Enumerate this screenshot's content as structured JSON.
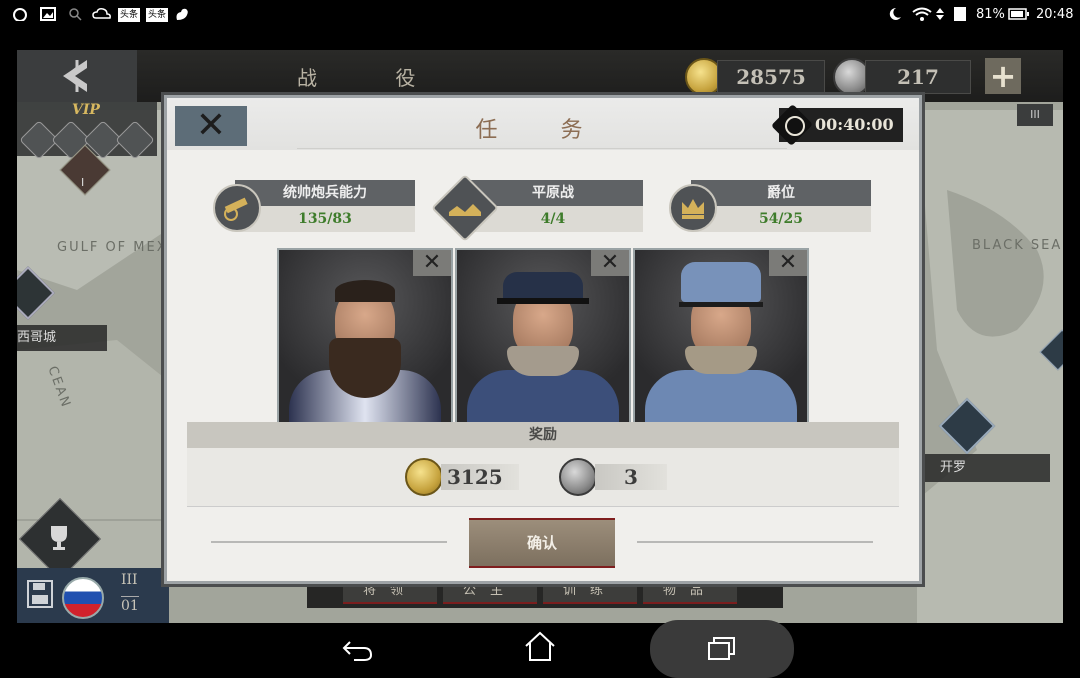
{
  "status_bar": {
    "battery": "81%",
    "time": "20:48",
    "app_icon_labels": [
      "头条",
      "头条"
    ]
  },
  "top_bar": {
    "title": "战 役",
    "coins": "28575",
    "medals": "217",
    "add_button": "+"
  },
  "left_panel": {
    "vip_label": "VIP",
    "turn_top": "III",
    "turn_bottom": "01",
    "region_label": "西哥城",
    "numeral_i": "I"
  },
  "map": {
    "gulf_label": "GULF OF MEXIC",
    "black_sea_label": "BLACK SEA",
    "cairo_label": "开罗",
    "ocean_text": "CEAN",
    "roman_iii": "III"
  },
  "bottom_tabs": [
    "将领",
    "公主",
    "训练",
    "物品"
  ],
  "dialog": {
    "title": "任 务",
    "timer": "00:40:00",
    "close_symbol": "✕",
    "requirements": [
      {
        "label": "统帅炮兵能力",
        "value": "135/83",
        "icon": "cannon-icon"
      },
      {
        "label": "平原战",
        "value": "4/4",
        "icon": "plains-icon"
      },
      {
        "label": "爵位",
        "value": "54/25",
        "icon": "crown-icon"
      }
    ],
    "generals": [
      {
        "name": "general-bearded-admiral",
        "remove": "✕"
      },
      {
        "name": "general-peaked-cap",
        "remove": "✕"
      },
      {
        "name": "general-kepi",
        "remove": "✕"
      }
    ],
    "rewards_title": "奖励",
    "reward_coins": "3125",
    "reward_medals": "3",
    "confirm_label": "确认"
  },
  "colors": {
    "title_brown": "#8c6d53",
    "progress_green": "#3e7c2b",
    "confirm_border": "#7f1e1e"
  }
}
